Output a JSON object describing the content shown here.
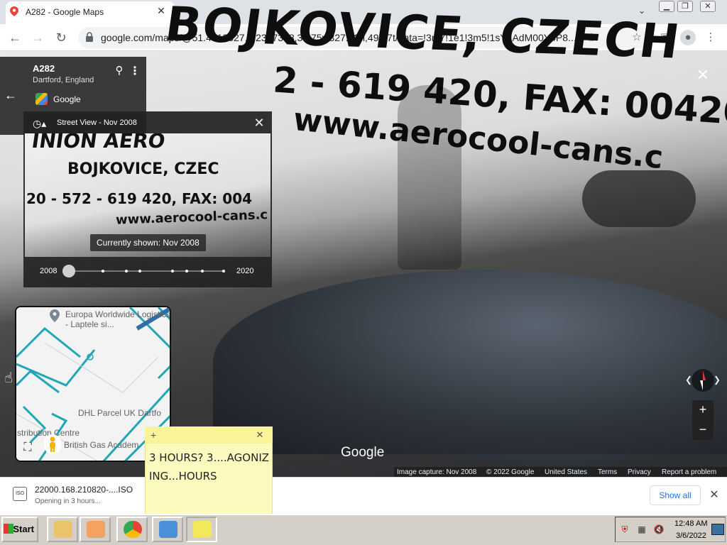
{
  "browser": {
    "tab_title": "A282 - Google Maps",
    "url": "google.com/maps/@51.4513627,0.2397358,3a,75y,327.42h,49.37t/data=!3m7!1e1!3m5!1sY1AdM00Y4P8..."
  },
  "streetview": {
    "truck_text_1": "BOJKOVICE,   CZECH",
    "truck_text_2": "2 - 619 420, FAX: 00420 -",
    "truck_text_3": "www.aerocool-cans.c",
    "preview_text_1": "BOJKOVICE,  CZEC",
    "preview_text_2": "20 - 572 - 619 420, FAX: 004",
    "preview_text_3": "www.aerocool-cans.c",
    "preview_text_top": "INION AERO"
  },
  "place_card": {
    "title": "A282",
    "subtitle": "Dartford, England",
    "provider": "Google"
  },
  "time_machine": {
    "label": "Street View - Nov 2008",
    "currently_shown": "Currently shown: Nov 2008",
    "year_start": "2008",
    "year_end": "2020"
  },
  "minimap": {
    "label_1": "Europa Worldwide Logistics - Laptele si...",
    "label_2": "DHL Parcel UK Dartfo",
    "label_3": "stribution Centre",
    "label_4": "British Gas Academ"
  },
  "map_footer": {
    "google_mark": "Google",
    "image_capture": "Image capture: Nov 2008",
    "copyright": "© 2022 Google",
    "country": "United States",
    "terms": "Terms",
    "privacy": "Privacy",
    "report": "Report a problem"
  },
  "download": {
    "file_name": "22000.168.210820-....ISO",
    "status": "Opening in 3 hours...",
    "icon_label": "ISO",
    "show_all": "Show all"
  },
  "sticky_note": {
    "text": "3 HOURS? 3....AGONIZING...HOURS"
  },
  "taskbar": {
    "start": "Start",
    "time": "12:48 AM",
    "date": "3/6/2022"
  },
  "colors": {
    "accent": "#1a73e8",
    "minimap_road": "#1fa7b8",
    "sticky_bg": "#fdfac0"
  }
}
